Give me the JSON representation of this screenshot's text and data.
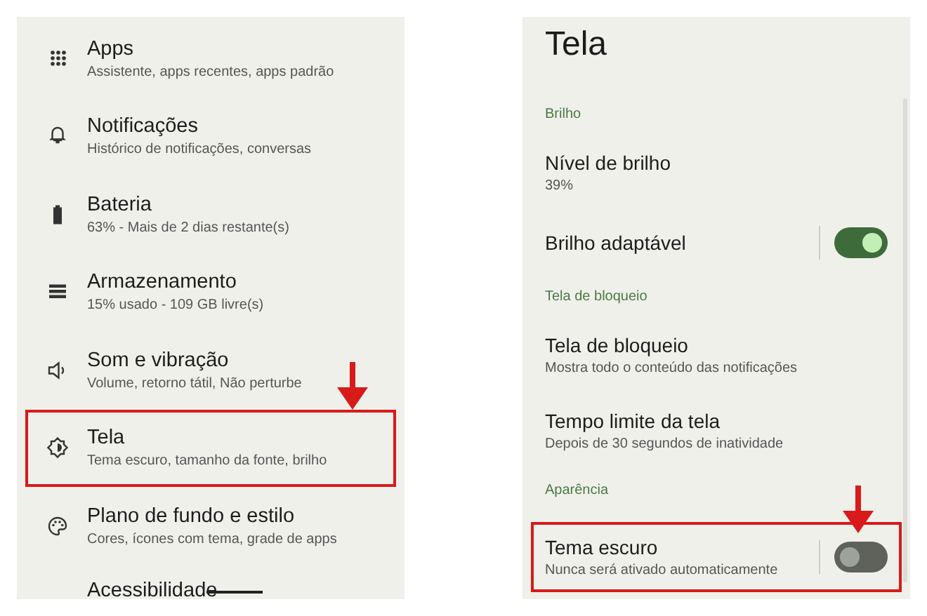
{
  "settings_list": [
    {
      "title": "Apps",
      "subtitle": "Assistente, apps recentes, apps padrão",
      "highlighted": false
    },
    {
      "title": "Notificações",
      "subtitle": "Histórico de notificações, conversas",
      "highlighted": false
    },
    {
      "title": "Bateria",
      "subtitle": "63% - Mais de 2 dias restante(s)",
      "highlighted": false
    },
    {
      "title": "Armazenamento",
      "subtitle": "15% usado - 109 GB livre(s)",
      "highlighted": false
    },
    {
      "title": "Som e vibração",
      "subtitle": "Volume, retorno tátil, Não perturbe",
      "highlighted": false
    },
    {
      "title": "Tela",
      "subtitle": "Tema escuro, tamanho da fonte, brilho",
      "highlighted": true
    },
    {
      "title": "Plano de fundo e estilo",
      "subtitle": "Cores, ícones com tema, grade de apps",
      "highlighted": false
    },
    {
      "title": "Acessibilidade",
      "highlighted": false
    }
  ],
  "display_screen": {
    "title": "Tela",
    "items": [
      {
        "kind": "header",
        "title": "Brilho"
      },
      {
        "kind": "item",
        "title": "Nível de brilho",
        "subtitle": "39%",
        "highlighted": false
      },
      {
        "kind": "toggle",
        "title": "Brilho adaptável",
        "on": true,
        "highlighted": false
      },
      {
        "kind": "header",
        "title": "Tela de bloqueio"
      },
      {
        "kind": "item",
        "title": "Tela de bloqueio",
        "subtitle": "Mostra todo o conteúdo das notificações",
        "highlighted": false
      },
      {
        "kind": "item",
        "title": "Tempo limite da tela",
        "subtitle": "Depois de 30 segundos de inatividade",
        "highlighted": false
      },
      {
        "kind": "header",
        "title": "Aparência"
      },
      {
        "kind": "toggle",
        "title": "Tema escuro",
        "subtitle": "Nunca será ativado automaticamente",
        "on": false,
        "highlighted": true
      }
    ]
  }
}
